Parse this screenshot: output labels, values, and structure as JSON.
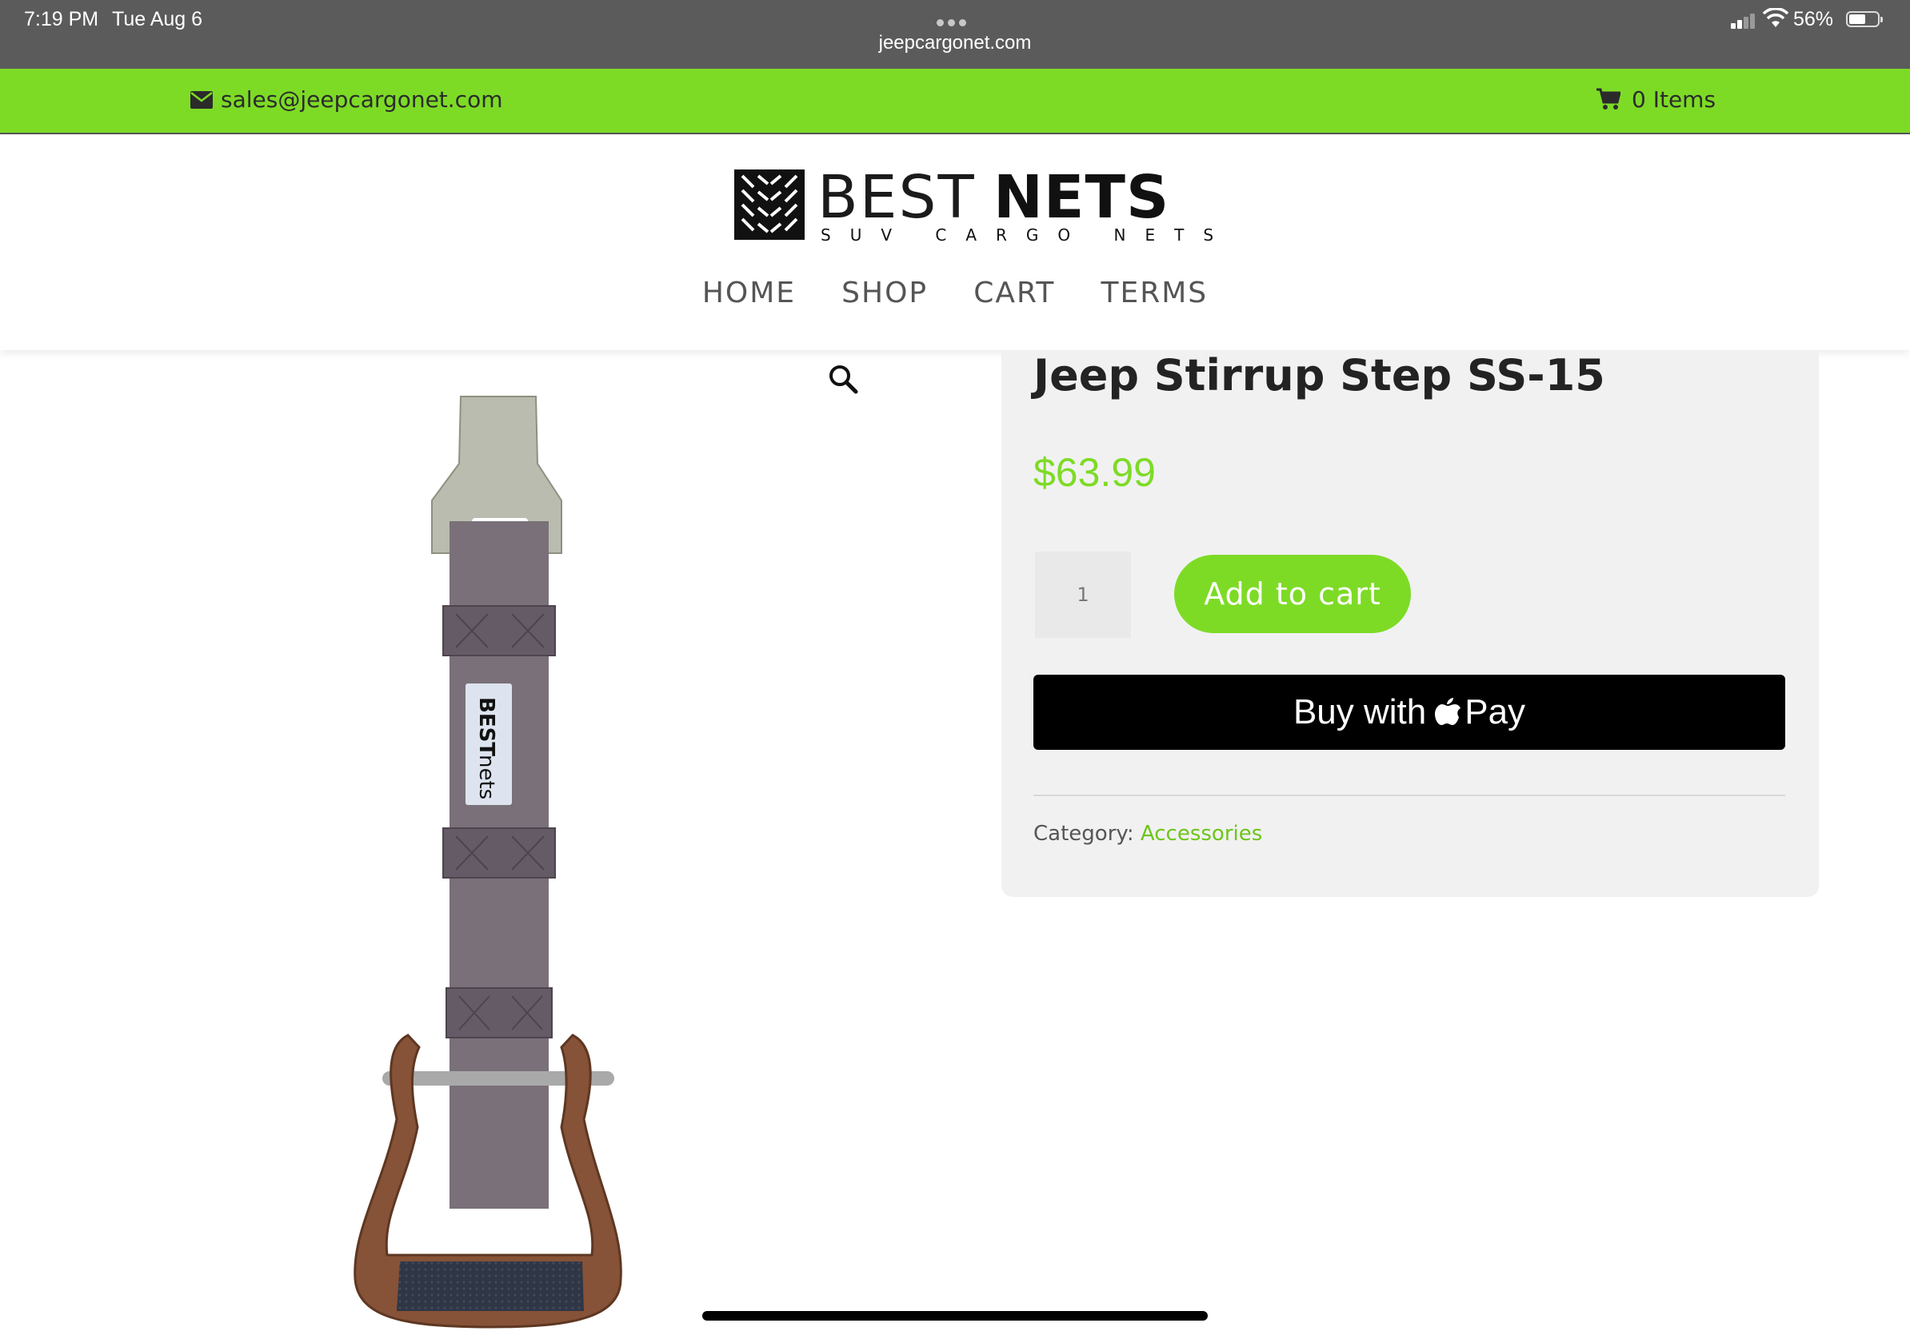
{
  "status_bar": {
    "time": "7:19 PM",
    "date": "Tue Aug 6",
    "url": "jeepcargonet.com",
    "battery": "56%",
    "battery_level": 0.56
  },
  "topbar": {
    "email": "sales@jeepcargonet.com",
    "cart": "0 Items",
    "color": "#7ddb26"
  },
  "logo": {
    "best": "BEST",
    "nets": "NETS",
    "tagline": "SUV CARGO NETS",
    "image_label_best": "BEST",
    "image_label_nets": "nets"
  },
  "nav": {
    "home": "HOME",
    "shop": "SHOP",
    "cart": "CART",
    "terms": "TERMS"
  },
  "product": {
    "title": "Jeep Stirrup Step SS-15",
    "price": "$63.99",
    "quantity": "1",
    "add_to_cart": "Add to cart",
    "apple_pay_prefix": "Buy with",
    "apple_pay_suffix": "Pay",
    "category_label": "Category:",
    "category_value": "Accessories"
  },
  "icons": {
    "mail": "envelope-icon",
    "cart": "cart-icon",
    "zoom": "magnifier-icon",
    "apple": "apple-logo-icon"
  }
}
